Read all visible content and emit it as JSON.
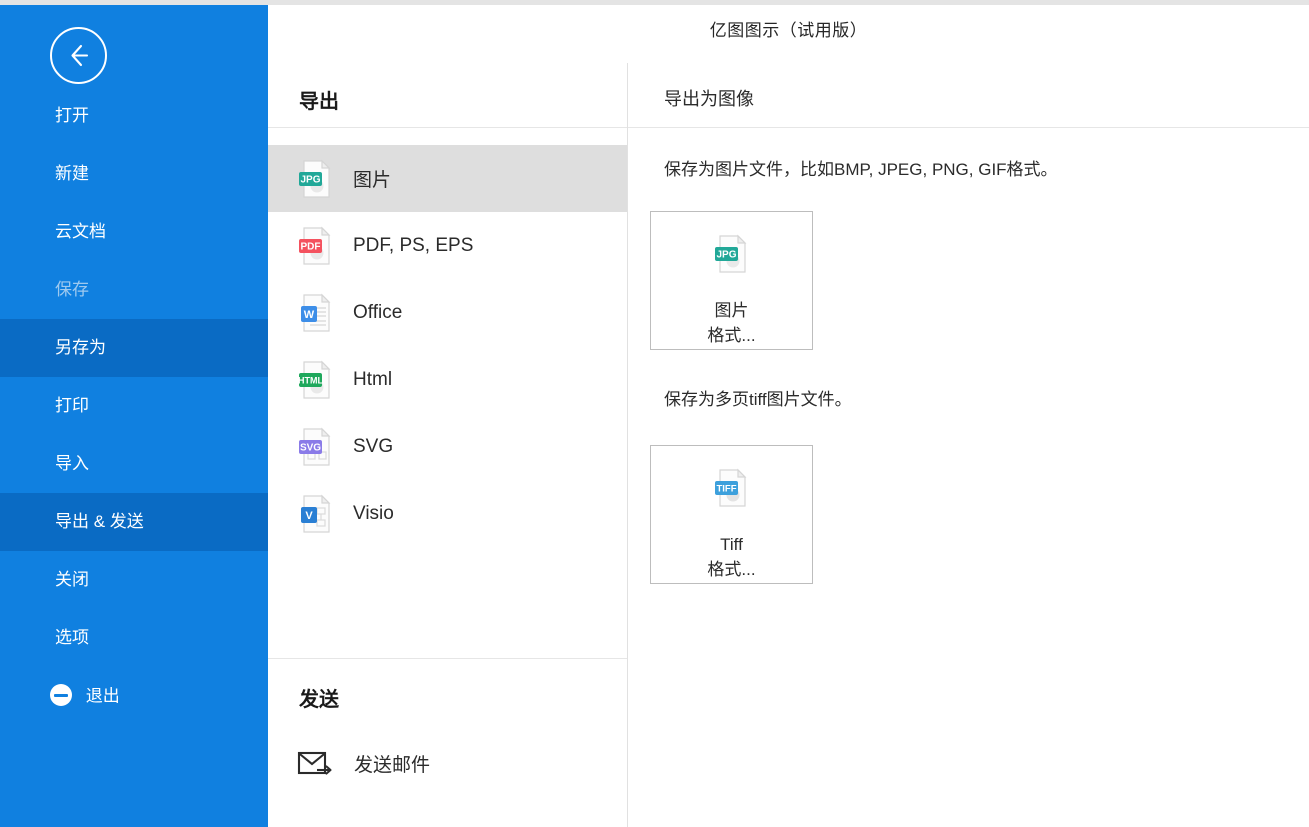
{
  "window": {
    "title": "亿图图示（试用版）"
  },
  "sidebar": {
    "back_icon": "back-arrow-icon",
    "items": [
      {
        "label": "打开",
        "state": "normal"
      },
      {
        "label": "新建",
        "state": "normal"
      },
      {
        "label": "云文档",
        "state": "normal"
      },
      {
        "label": "保存",
        "state": "disabled"
      },
      {
        "label": "另存为",
        "state": "selected"
      },
      {
        "label": "打印",
        "state": "normal"
      },
      {
        "label": "导入",
        "state": "normal"
      },
      {
        "label": "导出 & 发送",
        "state": "active"
      },
      {
        "label": "关闭",
        "state": "normal"
      },
      {
        "label": "选项",
        "state": "normal"
      },
      {
        "label": "退出",
        "state": "exit",
        "icon": "exit-circle-icon"
      }
    ]
  },
  "middle": {
    "export_heading": "导出",
    "export_items": [
      {
        "label": "图片",
        "icon": "jpg-file-icon",
        "badge": "JPG",
        "color": "#21a898",
        "selected": true
      },
      {
        "label": "PDF, PS, EPS",
        "icon": "pdf-file-icon",
        "badge": "PDF",
        "color": "#f4525f",
        "selected": false
      },
      {
        "label": "Office",
        "icon": "word-file-icon",
        "badge": "W",
        "color": "#3d8ee8",
        "selected": false
      },
      {
        "label": "Html",
        "icon": "html-file-icon",
        "badge": "HTML",
        "color": "#1fa85c",
        "selected": false
      },
      {
        "label": "SVG",
        "icon": "svg-file-icon",
        "badge": "SVG",
        "color": "#8a7be8",
        "selected": false
      },
      {
        "label": "Visio",
        "icon": "visio-file-icon",
        "badge": "V",
        "color": "#2a7fd4",
        "selected": false
      }
    ],
    "send_heading": "发送",
    "send_items": [
      {
        "label": "发送邮件",
        "icon": "send-mail-icon"
      }
    ]
  },
  "right": {
    "heading": "导出为图像",
    "sections": [
      {
        "description": "保存为图片文件，比如BMP, JPEG, PNG, GIF格式。",
        "card": {
          "icon": "jpg-file-icon",
          "badge": "JPG",
          "color": "#21a898",
          "line1": "图片",
          "line2": "格式..."
        }
      },
      {
        "description": "保存为多页tiff图片文件。",
        "card": {
          "icon": "tiff-file-icon",
          "badge": "TIFF",
          "color": "#3da0dc",
          "line1": "Tiff",
          "line2": "格式..."
        }
      }
    ]
  },
  "colors": {
    "sidebar_bg": "#1080e0",
    "sidebar_selected": "#0a6bc4",
    "sidebar_disabled_text": "#9ec9ef",
    "row_selected_bg": "#dedede",
    "divider": "#e6e6e6"
  }
}
